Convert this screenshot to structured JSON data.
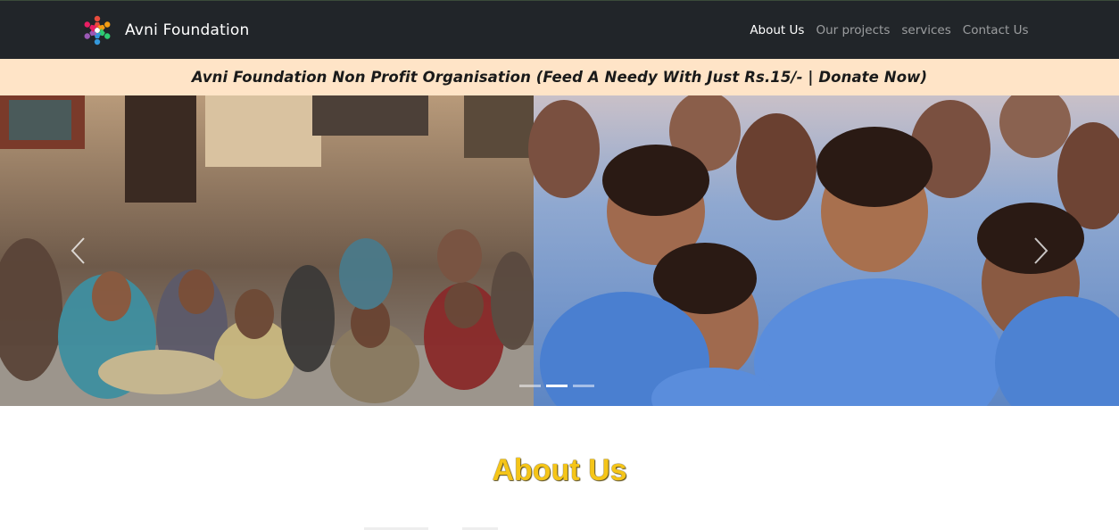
{
  "navbar": {
    "brand": "Avni Foundation",
    "logo_icon": "colorful-people-circle-logo",
    "links": [
      {
        "label": "About Us",
        "active": true
      },
      {
        "label": "Our projects",
        "active": false
      },
      {
        "label": "services",
        "active": false
      },
      {
        "label": "Contact Us",
        "active": false
      }
    ]
  },
  "banner": {
    "text": "Avni Foundation Non Profit Organisation (Feed A Needy With Just Rs.15/- | Donate Now)",
    "background": "#ffe4c7"
  },
  "carousel": {
    "prev_icon": "chevron-left-icon",
    "next_icon": "chevron-right-icon",
    "slide_count": 3,
    "active_slide": 2
  },
  "about": {
    "title": "About Us",
    "title_color": "#f5c518"
  }
}
